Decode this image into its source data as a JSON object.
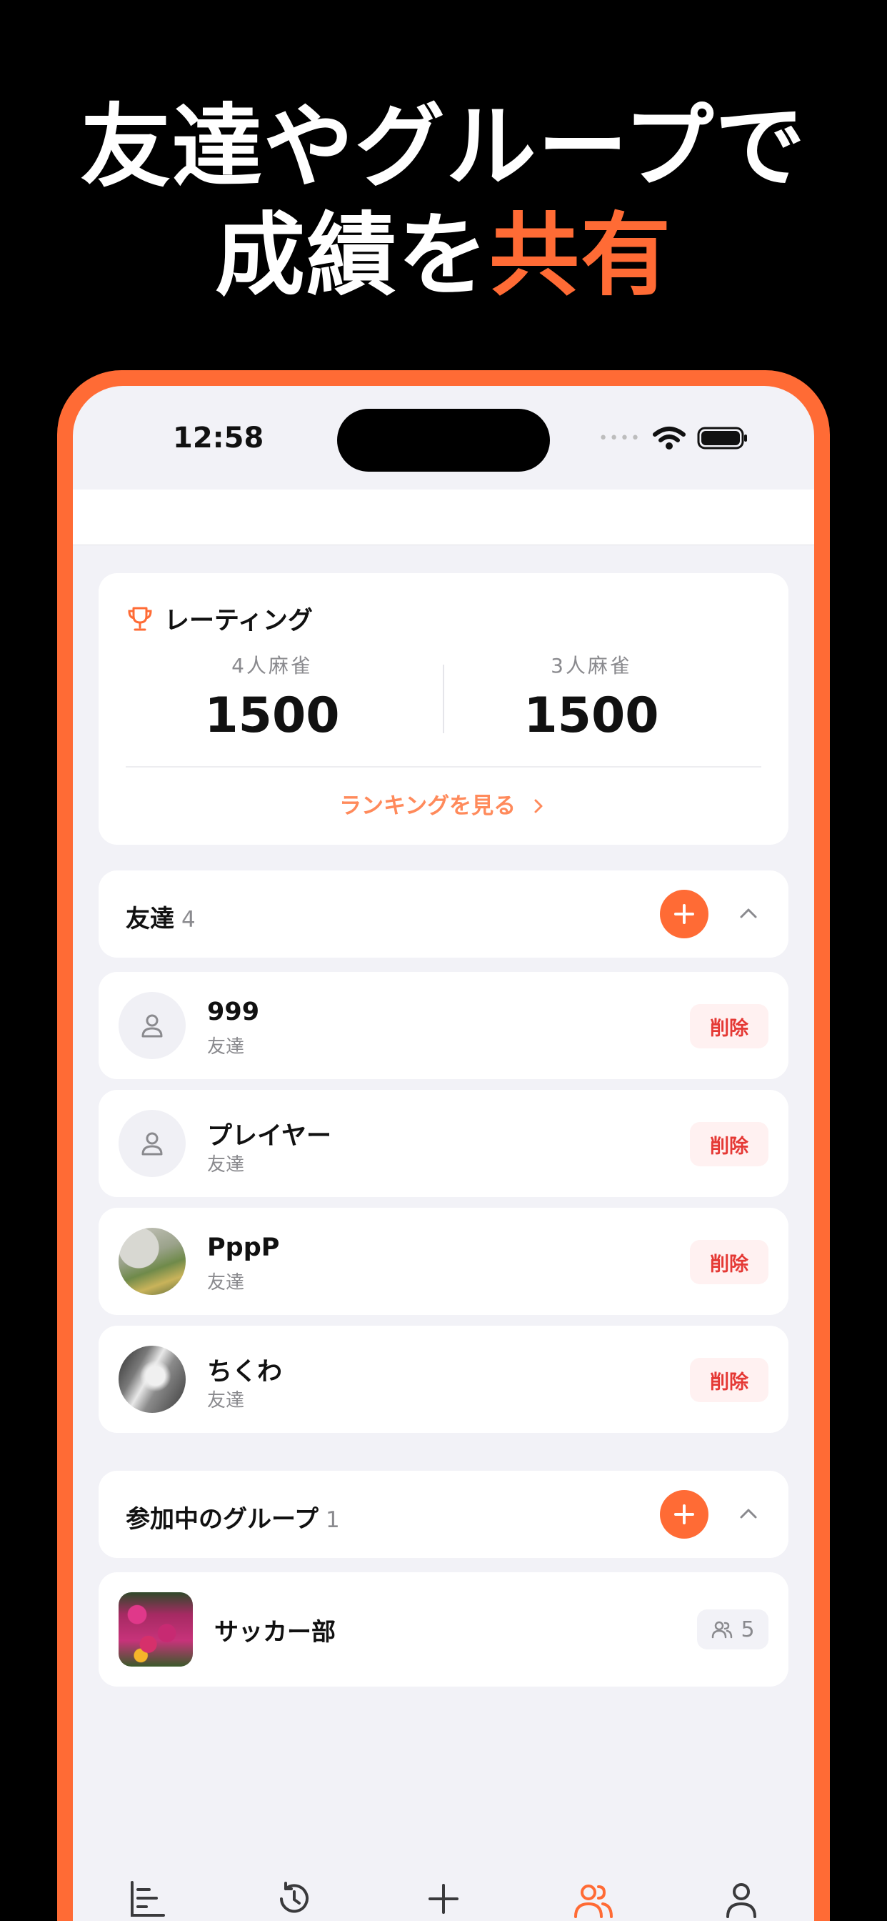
{
  "headline": {
    "line1": "友達やグループで",
    "line2_plain": "成績を",
    "line2_accent": "共有",
    "accent_color": "#FF6B35"
  },
  "status_bar": {
    "time": "12:58",
    "icons": [
      "cellular-dots-icon",
      "wifi-icon",
      "battery-icon"
    ]
  },
  "rating": {
    "icon": "trophy-icon",
    "title": "レーティング",
    "four_player_label": "4人麻雀",
    "four_player_value": "1500",
    "three_player_label": "3人麻雀",
    "three_player_value": "1500",
    "ranking_link": "ランキングを見る"
  },
  "friends": {
    "title": "友達",
    "count": "4",
    "items": [
      {
        "name": "999",
        "sub": "友達",
        "avatar": "person-icon",
        "delete_label": "削除"
      },
      {
        "name": "プレイヤー",
        "sub": "友達",
        "avatar": "person-icon",
        "delete_label": "削除"
      },
      {
        "name": "PppP",
        "sub": "友達",
        "avatar": "photo",
        "delete_label": "削除"
      },
      {
        "name": "ちくわ",
        "sub": "友達",
        "avatar": "photo",
        "delete_label": "削除"
      }
    ]
  },
  "groups": {
    "title": "参加中のグループ",
    "count": "1",
    "items": [
      {
        "name": "サッカー部",
        "member_count": "5",
        "member_icon": "people-icon"
      }
    ]
  },
  "tab_bar": {
    "tabs": [
      {
        "icon": "stats-icon",
        "active": false
      },
      {
        "icon": "history-icon",
        "active": false
      },
      {
        "icon": "plus-icon",
        "active": false
      },
      {
        "icon": "friends-icon",
        "active": true
      },
      {
        "icon": "profile-icon",
        "active": false
      }
    ],
    "active_color": "#FF6B35"
  }
}
